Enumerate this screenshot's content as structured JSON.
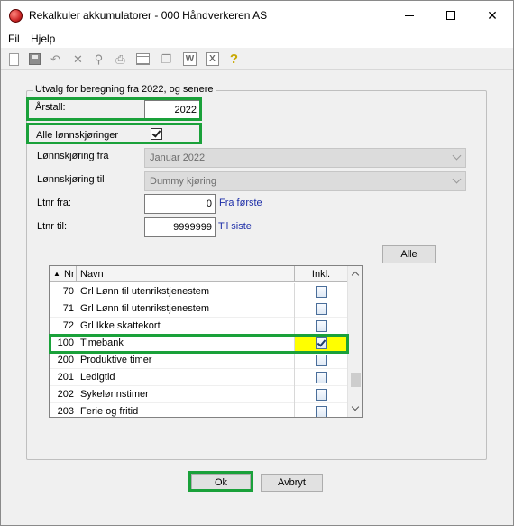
{
  "window": {
    "title": "Rekalkuler akkumulatorer - 000 Håndverkeren AS"
  },
  "menu": {
    "file": "Fil",
    "help": "Hjelp"
  },
  "toolbar": {
    "icons": [
      "new-document-icon",
      "save-icon",
      "undo-icon",
      "delete-icon",
      "find-icon",
      "print-icon",
      "grid-icon",
      "copy-icon",
      "word-icon",
      "excel-icon",
      "help-icon"
    ]
  },
  "form": {
    "group_title": "Utvalg for beregning fra 2022, og senere",
    "year_label": "Årstall:",
    "year_value": "2022",
    "all_runs_label": "Alle lønnskjøringer",
    "all_runs_checked": true,
    "run_from_label": "Lønnskjøring fra",
    "run_from_value": "Januar 2022",
    "run_to_label": "Lønnskjøring til",
    "run_to_value": "Dummy kjøring",
    "ltnr_from_label": "Ltnr fra:",
    "ltnr_from_value": "0",
    "ltnr_from_link": "Fra første",
    "ltnr_to_label": "Ltnr til:",
    "ltnr_to_value": "9999999",
    "ltnr_to_link": "Til siste",
    "all_button": "Alle"
  },
  "grid": {
    "sort_glyph": "▲",
    "columns": {
      "nr": "Nr",
      "navn": "Navn",
      "inkl": "Inkl."
    },
    "rows": [
      {
        "nr": "70",
        "navn": "Grl Lønn til utenrikstjenestem",
        "inkl": false
      },
      {
        "nr": "71",
        "navn": "Grl Lønn til utenrikstjenestem",
        "inkl": false
      },
      {
        "nr": "72",
        "navn": "Grl Ikke skattekort",
        "inkl": false
      },
      {
        "nr": "100",
        "navn": "Timebank",
        "inkl": true
      },
      {
        "nr": "200",
        "navn": "Produktive timer",
        "inkl": false
      },
      {
        "nr": "201",
        "navn": "Ledigtid",
        "inkl": false
      },
      {
        "nr": "202",
        "navn": "Sykelønnstimer",
        "inkl": false
      },
      {
        "nr": "203",
        "navn": "Ferie og fritid",
        "inkl": false
      }
    ]
  },
  "buttons": {
    "ok": "Ok",
    "cancel": "Avbryt"
  },
  "colors": {
    "highlight_green": "#1aa13a",
    "selected_cell_yellow": "#ffff00",
    "link_blue": "#1d2ea8"
  }
}
